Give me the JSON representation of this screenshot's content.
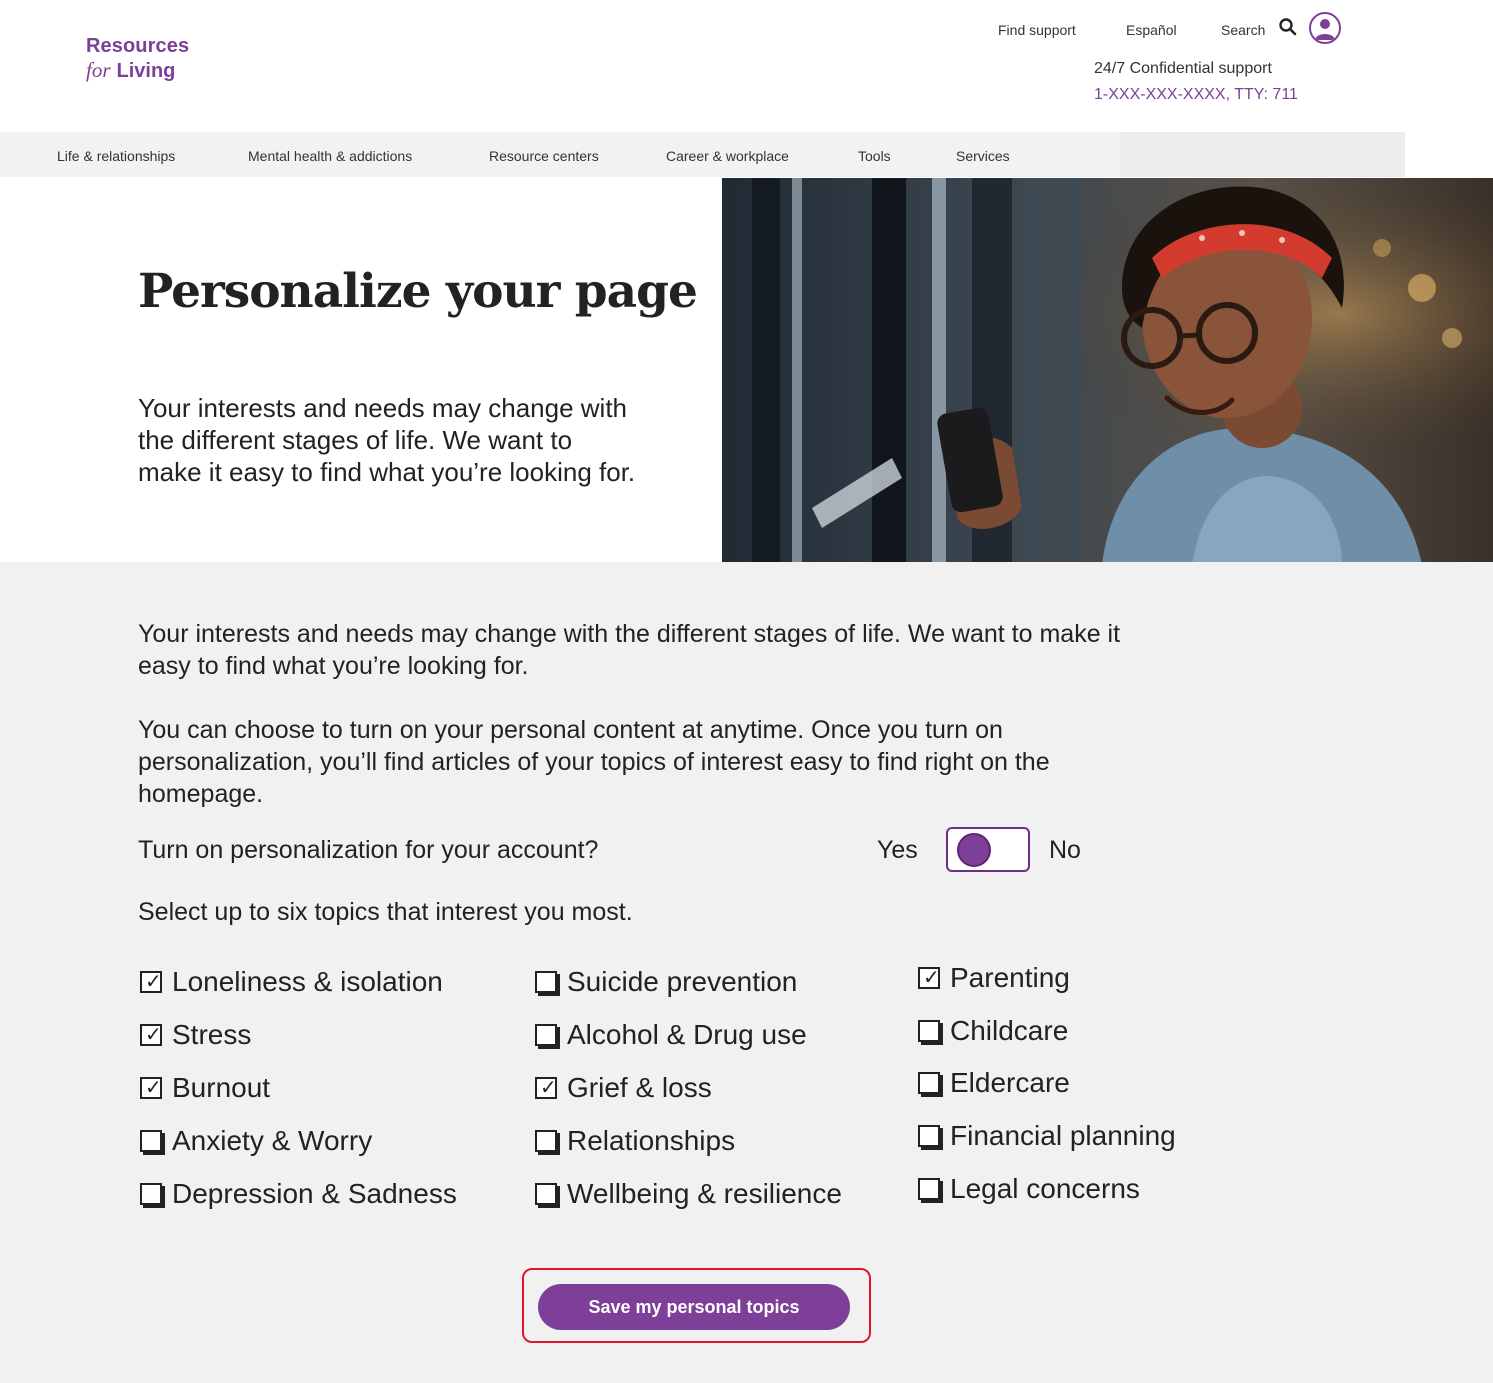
{
  "brand": {
    "line1": "Resources",
    "line2_for": "for",
    "line2_living": "Living",
    "accent": "#7d3f98"
  },
  "utility": {
    "find_support": "Find support",
    "espanol": "Español",
    "search": "Search"
  },
  "support": {
    "label": "24/7 Confidential support",
    "phone": "1-XXX-XXX-XXXX, TTY: 711"
  },
  "nav": {
    "items": [
      "Life & relationships",
      "Mental health & addictions",
      "Resource centers",
      "Career & workplace",
      "Tools",
      "Services"
    ]
  },
  "hero": {
    "title": "Personalize your page",
    "text": "Your interests and needs may change with the different stages of life. We want to make it easy to find what you’re looking for."
  },
  "main": {
    "p1": "Your interests and needs may change with the different stages of life. We want to make it easy to find what you’re looking for.",
    "p2": "You can choose to turn on your personal content at anytime. Once you turn on personalization, you’ll find articles of your topics of interest easy to find right on the homepage.",
    "question": "Turn on personalization for your account?",
    "yes": "Yes",
    "no": "No",
    "select_prompt": "Select up to six topics that interest you most."
  },
  "topics": {
    "col1": [
      {
        "label": "Loneliness & isolation",
        "checked": true
      },
      {
        "label": "Stress",
        "checked": true
      },
      {
        "label": "Burnout",
        "checked": true
      },
      {
        "label": "Anxiety & Worry",
        "checked": false
      },
      {
        "label": "Depression & Sadness",
        "checked": false
      }
    ],
    "col2": [
      {
        "label": "Suicide prevention",
        "checked": false
      },
      {
        "label": "Alcohol & Drug use",
        "checked": false
      },
      {
        "label": "Grief & loss",
        "checked": true
      },
      {
        "label": "Relationships",
        "checked": false
      },
      {
        "label": "Wellbeing & resilience",
        "checked": false
      }
    ],
    "col3": [
      {
        "label": "Parenting",
        "checked": true
      },
      {
        "label": "Childcare",
        "checked": false
      },
      {
        "label": "Eldercare",
        "checked": false
      },
      {
        "label": "Financial planning",
        "checked": false
      },
      {
        "label": "Legal concerns",
        "checked": false
      }
    ]
  },
  "save_button": "Save my personal topics"
}
